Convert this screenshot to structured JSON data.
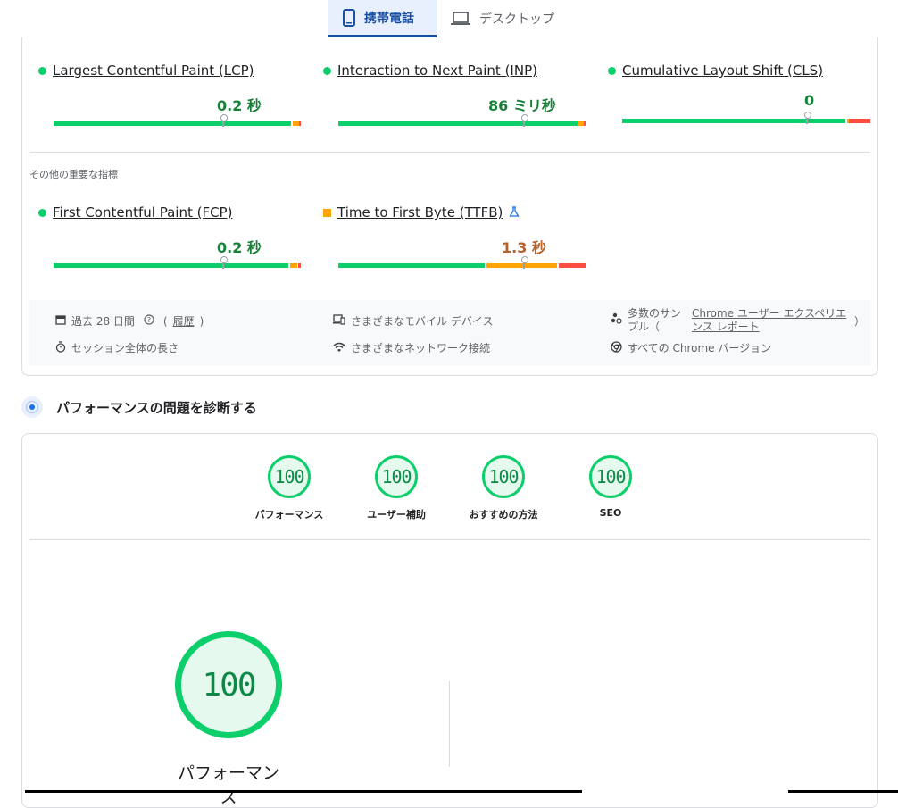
{
  "tabs": [
    {
      "label": "携帯電話",
      "icon": "smartphone-icon",
      "active": true
    },
    {
      "label": "デスクトップ",
      "icon": "laptop-icon",
      "active": false
    }
  ],
  "core_metrics": [
    {
      "name": "Largest Contentful Paint (LCP)",
      "value": "0.2 秒",
      "status": "good"
    },
    {
      "name": "Interaction to Next Paint (INP)",
      "value": "86 ミリ秒",
      "status": "good"
    },
    {
      "name": "Cumulative Layout Shift (CLS)",
      "value": "0",
      "status": "good"
    }
  ],
  "other_label": "その他の重要な指標",
  "other_metrics": [
    {
      "name": "First Contentful Paint (FCP)",
      "value": "0.2 秒",
      "status": "good"
    },
    {
      "name": "Time to First Byte (TTFB)",
      "value": "1.3 秒",
      "status": "needs-improvement",
      "experimental_icon": "flask-icon"
    }
  ],
  "info": {
    "period": "過去 28 日間",
    "history": "履歴",
    "devices": "さまざまなモバイル デバイス",
    "samples_prefix": "多数のサンプル（",
    "samples_link": "Chrome ユーザー エクスペリエンス レポート",
    "samples_suffix": "）",
    "session": "セッション全体の長さ",
    "network": "さまざまなネットワーク接続",
    "chrome": "すべての Chrome バージョン"
  },
  "diagnose_title": "パフォーマンスの問題を診断する",
  "categories": [
    {
      "label": "パフォーマンス",
      "score": "100"
    },
    {
      "label": "ユーザー補助",
      "score": "100"
    },
    {
      "label": "おすすめの方法",
      "score": "100"
    },
    {
      "label": "SEO",
      "score": "100"
    }
  ],
  "main_score": {
    "label": "パフォーマンス",
    "score": "100"
  },
  "colors": {
    "good": "#0cce6b",
    "average": "#ffa400",
    "poor": "#ff4e42",
    "accent": "#1a4fa0"
  }
}
